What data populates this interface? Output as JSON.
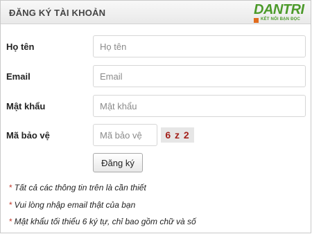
{
  "header": {
    "title": "ĐĂNG KÝ TÀI KHOẢN",
    "logo_text": "DANTRI",
    "logo_tagline": "KẾT NỐI BẠN ĐỌC"
  },
  "form": {
    "name": {
      "label": "Họ tên",
      "placeholder": "Họ tên",
      "value": ""
    },
    "email": {
      "label": "Email",
      "placeholder": "Email",
      "value": ""
    },
    "password": {
      "label": "Mật khẩu",
      "placeholder": "Mật khẩu",
      "value": ""
    },
    "captcha": {
      "label": "Mã bảo vệ",
      "placeholder": "Mã bảo vệ",
      "value": "",
      "code": "6 z 2"
    },
    "submit_label": "Đăng ký"
  },
  "notes": [
    {
      "star": "*",
      "text": "Tất cả các thông tin trên là cần thiết"
    },
    {
      "star": "*",
      "text": "Vui lòng nhập email thật của bạn"
    },
    {
      "star": "*",
      "text": "Mật khẩu tối thiểu 6 ký tự, chỉ bao gồm chữ và số"
    }
  ],
  "colors": {
    "logo_green": "#4c9a2a",
    "captcha_red": "#a3201a",
    "note_star": "#c0392b"
  }
}
